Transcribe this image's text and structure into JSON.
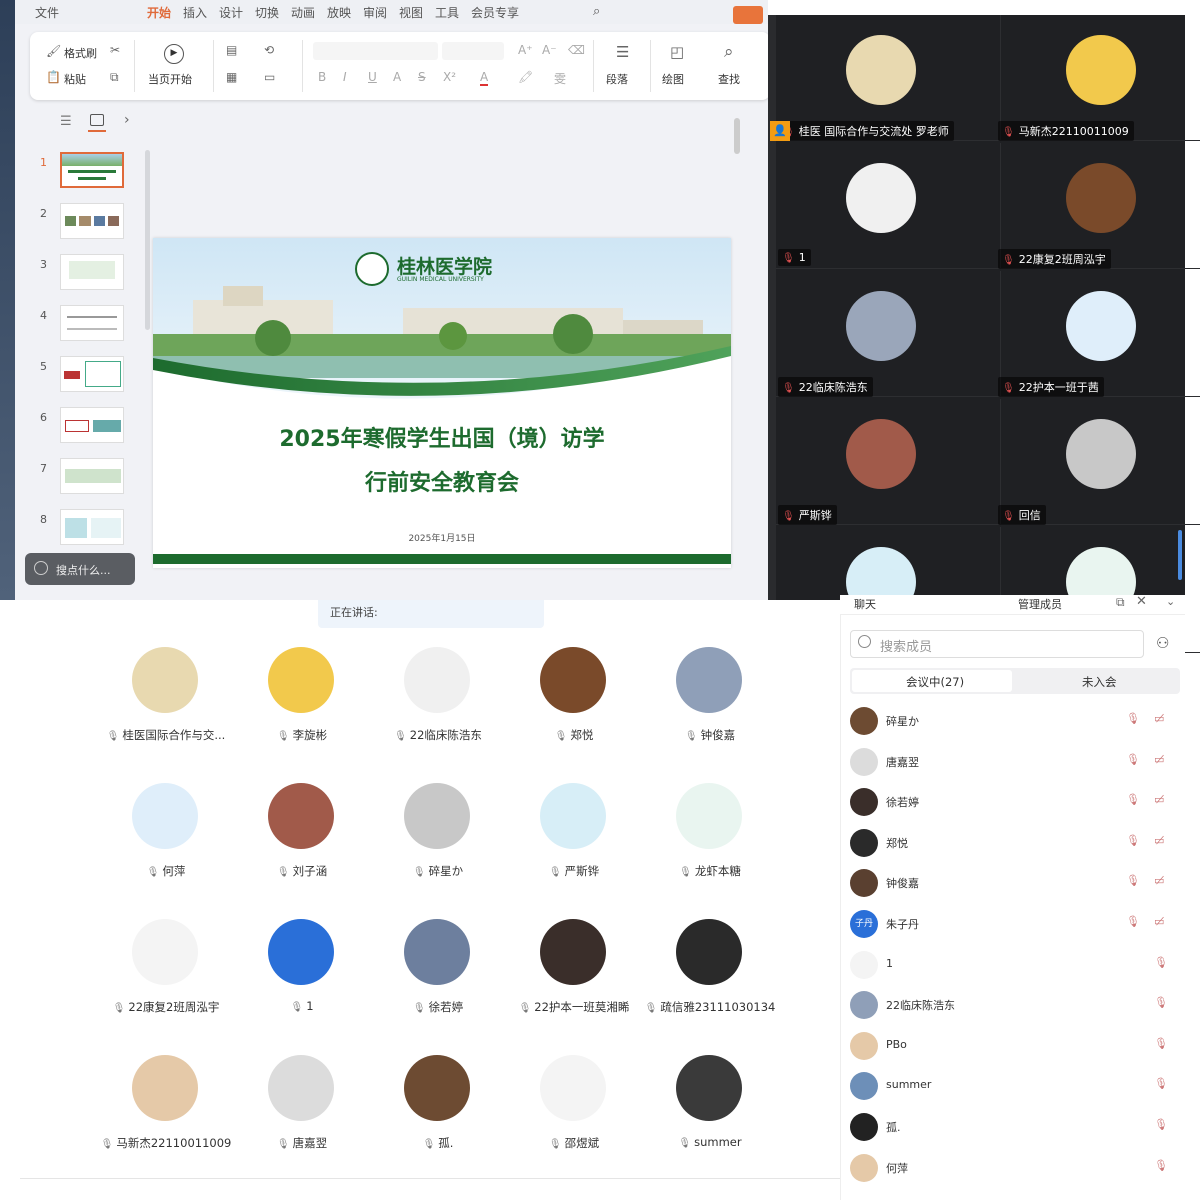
{
  "wps": {
    "menu": [
      "文件",
      "开始",
      "插入",
      "设计",
      "切换",
      "动画",
      "放映",
      "审阅",
      "视图",
      "工具",
      "会员专享"
    ],
    "ribbon": {
      "format_painter": "格式刷",
      "paste": "粘贴",
      "start_from_current": "当页开始",
      "bold": "B",
      "italic": "I",
      "underline": "U",
      "superscript": "X²",
      "paragraph": "段落",
      "drawing": "绘图",
      "find": "查找",
      "font_a_plus": "A⁺",
      "font_a_minus": "A⁻"
    },
    "thumbnails": [
      "1",
      "2",
      "3",
      "4",
      "5",
      "6",
      "7",
      "8"
    ],
    "find_placeholder": "搜点什么...",
    "slide": {
      "logo_cn": "桂林医学院",
      "logo_en": "GUILIN MEDICAL UNIVERSITY",
      "title_line1": "2025年寒假学生出国（境）访学",
      "title_line2": "行前安全教育会",
      "date": "2025年1月15日"
    }
  },
  "video_grid": [
    {
      "name": "桂医 国际合作与交流处 罗老师"
    },
    {
      "name": "马新杰22110011009"
    },
    {
      "name": "1"
    },
    {
      "name": "22康复2班周泓宇"
    },
    {
      "name": "22临床陈浩东"
    },
    {
      "name": "22护本一班于茜"
    },
    {
      "name": "严斯铧"
    },
    {
      "name": "回信"
    },
    {
      "name": ""
    },
    {
      "name": ""
    }
  ],
  "speaking_label": "正在讲话:",
  "participants": [
    {
      "name": "桂医国际合作与交..."
    },
    {
      "name": "李旋彬"
    },
    {
      "name": "22临床陈浩东"
    },
    {
      "name": "郑悦"
    },
    {
      "name": "钟俊嘉"
    },
    {
      "name": "何萍"
    },
    {
      "name": "刘子涵"
    },
    {
      "name": "碎星か"
    },
    {
      "name": "严斯铧"
    },
    {
      "name": "龙虾本糖"
    },
    {
      "name": "22康复2班周泓宇"
    },
    {
      "name": "1"
    },
    {
      "name": "徐若婷"
    },
    {
      "name": "22护本一班莫湘睎"
    },
    {
      "name": "疏信雅23111030134"
    },
    {
      "name": "马新杰22110011009"
    },
    {
      "name": "唐嘉翌"
    },
    {
      "name": "孤."
    },
    {
      "name": "邵煜斌"
    },
    {
      "name": "summer"
    }
  ],
  "members_panel": {
    "tab_chat": "聊天",
    "tab_manage": "管理成员",
    "search_placeholder": "搜索成员",
    "seg_in_meeting": "会议中(27)",
    "seg_not_joined": "未入会",
    "rows": [
      {
        "name": "碎星か",
        "avatar_text": ""
      },
      {
        "name": "唐嘉翌",
        "avatar_text": ""
      },
      {
        "name": "徐若婷",
        "avatar_text": ""
      },
      {
        "name": "郑悦",
        "avatar_text": ""
      },
      {
        "name": "钟俊嘉",
        "avatar_text": ""
      },
      {
        "name": "朱子丹",
        "avatar_text": "子丹"
      },
      {
        "name": "1",
        "avatar_text": ""
      },
      {
        "name": "22临床陈浩东",
        "avatar_text": ""
      },
      {
        "name": "PBo",
        "avatar_text": ""
      },
      {
        "name": "summer",
        "avatar_text": ""
      },
      {
        "name": "孤.",
        "avatar_text": ""
      },
      {
        "name": "何萍",
        "avatar_text": ""
      }
    ]
  }
}
